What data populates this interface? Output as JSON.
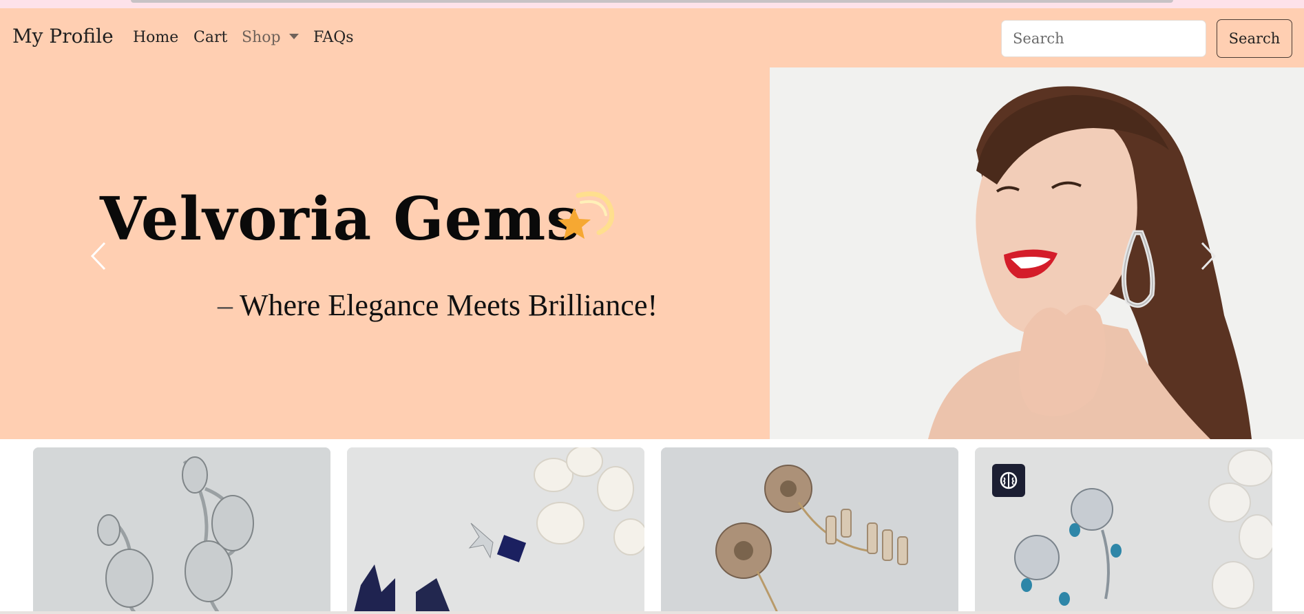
{
  "navbar": {
    "brand": "My Profile",
    "links": [
      {
        "label": "Home"
      },
      {
        "label": "Cart"
      },
      {
        "label": "Shop"
      },
      {
        "label": "FAQs"
      }
    ],
    "search_placeholder": "Search",
    "search_button": "Search"
  },
  "hero": {
    "title": "Velvoria Gems",
    "dash": "–",
    "subtitle": "Where Elegance Meets Brilliance!",
    "background_color": "#ffcfb2",
    "star_icon": "shooting-star-icon"
  },
  "carousel": {
    "prev_icon": "chevron-left-icon",
    "next_icon": "chevron-right-icon"
  },
  "products": [
    {
      "name": "silver-leaf-earrings"
    },
    {
      "name": "sapphire-drop-earrings"
    },
    {
      "name": "flower-pearl-earrings"
    },
    {
      "name": "blue-rose-earrings",
      "badge_icon": "brain-icon"
    }
  ],
  "colors": {
    "nav_bg": "#ffcfb2",
    "badge_bg": "#1c1f33",
    "star": "#f6a832"
  }
}
